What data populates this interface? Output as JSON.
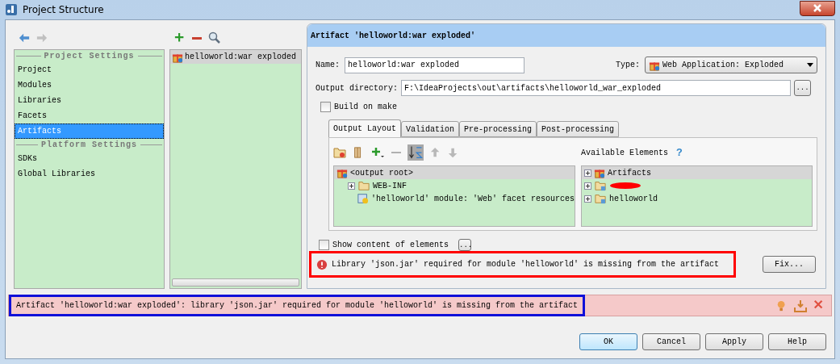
{
  "window": {
    "title": "Project Structure"
  },
  "nav": {
    "sections": [
      {
        "heading": "Project Settings",
        "items": [
          {
            "label": "Project",
            "selected": false
          },
          {
            "label": "Modules",
            "selected": false
          },
          {
            "label": "Libraries",
            "selected": false
          },
          {
            "label": "Facets",
            "selected": false
          },
          {
            "label": "Artifacts",
            "selected": true
          }
        ]
      },
      {
        "heading": "Platform Settings",
        "items": [
          {
            "label": "SDKs",
            "selected": false
          },
          {
            "label": "Global Libraries",
            "selected": false
          }
        ]
      }
    ]
  },
  "artifacts_list": {
    "items": [
      {
        "label": "helloworld:war exploded",
        "selected": true
      }
    ]
  },
  "detail": {
    "title": "Artifact 'helloworld:war exploded'",
    "name_label": "Name:",
    "name_value": "helloworld:war exploded",
    "type_label": "Type:",
    "type_value": "Web Application: Exploded",
    "output_label": "Output directory:",
    "output_value": "F:\\IdeaProjects\\out\\artifacts\\helloworld_war_exploded",
    "browse": "...",
    "build_on_make": {
      "label": "Build on make",
      "checked": false
    },
    "tabs": [
      {
        "label": "Output Layout",
        "selected": true
      },
      {
        "label": "Validation",
        "selected": false
      },
      {
        "label": "Pre-processing",
        "selected": false
      },
      {
        "label": "Post-processing",
        "selected": false
      }
    ],
    "layout_tree": [
      {
        "label": "<output root>",
        "kind": "root",
        "selected": true,
        "children": [
          {
            "label": "WEB-INF",
            "kind": "folder",
            "selected": false
          },
          {
            "label": "'helloworld' module: 'Web' facet resources",
            "kind": "module",
            "selected": false
          }
        ]
      }
    ],
    "available_title": "Available Elements",
    "help": "?",
    "available_tree": [
      {
        "label": "Artifacts",
        "kind": "artifacts",
        "selected": true
      },
      {
        "kind": "redacted",
        "selected": false
      },
      {
        "label": "helloworld",
        "kind": "module_folder",
        "selected": false
      }
    ],
    "show_content": {
      "label": "Show content of elements",
      "checked": false
    },
    "more": "...",
    "problem": "Library 'json.jar' required for module 'helloworld' is missing from the artifact",
    "fix": "Fix..."
  },
  "status": {
    "message": "Artifact 'helloworld:war exploded': library 'json.jar' required for module 'helloworld' is missing from the artifact"
  },
  "buttons": [
    {
      "label": "OK",
      "default": true
    },
    {
      "label": "Cancel",
      "default": false
    },
    {
      "label": "Apply",
      "default": false
    },
    {
      "label": "Help",
      "default": false
    }
  ]
}
